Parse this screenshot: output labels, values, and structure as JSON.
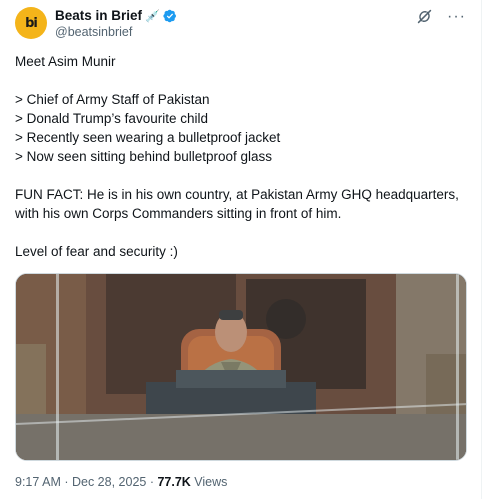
{
  "account": {
    "avatar_text": "bi",
    "display_name": "Beats in Brief",
    "handle": "@beatsinbrief",
    "verified_color": "#1d9bf0",
    "avatar_color": "#f4b41a"
  },
  "icons": {
    "grok": "grok-icon",
    "more": "more-icon",
    "syringe": "syringe-icon",
    "verified": "verified-badge-icon"
  },
  "tweet": {
    "line1": "Meet Asim Munir",
    "bullet1": "> Chief of Army Staff of Pakistan",
    "bullet2": "> Donald Trump’s favourite child",
    "bullet3": "> Recently seen wearing a bulletproof jacket",
    "bullet4": "> Now seen sitting behind bulletproof glass",
    "fun_fact_1": "FUN FACT: He is in his own country, at Pakistan Army GHQ headquarters,",
    "fun_fact_2": "with his own Corps Commanders sitting in front of him.",
    "closing": "Level of fear and security :)"
  },
  "meta": {
    "time": "9:17 AM",
    "separator": " · ",
    "date": "Dec 28, 2025",
    "views_count": "77.7K",
    "views_label": " Views"
  }
}
